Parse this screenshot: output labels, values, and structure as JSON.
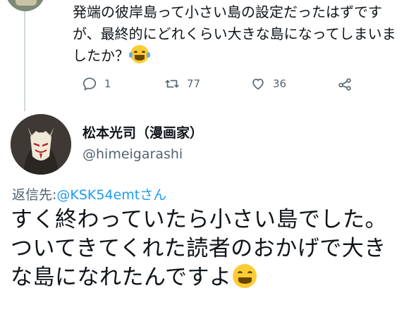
{
  "parent_tweet": {
    "text": "発端の彼岸島って小さい島の設定だったはずですが、最終的にどれくらい大きな島になってしまいましたか？",
    "emoji": "rolling-on-floor-laughing-emoji",
    "actions": {
      "reply_count": "1",
      "retweet_count": "77",
      "like_count": "36"
    }
  },
  "reply_tweet": {
    "author_name": "松本光司（漫画家）",
    "author_handle": "@himeigarashi",
    "reply_to_prefix": "返信先: ",
    "reply_to_mention": "@KSK54emtさん",
    "text": "すく終わっていたら小さい島でした。\nついてきてくれた読者のおかげで大きな島になれたんですよ",
    "emoji": "grinning-squinting-face-emoji"
  },
  "colors": {
    "text_primary": "#0f1419",
    "text_secondary": "#536471",
    "link": "#1d9bf0",
    "divider": "#cfd9de"
  }
}
